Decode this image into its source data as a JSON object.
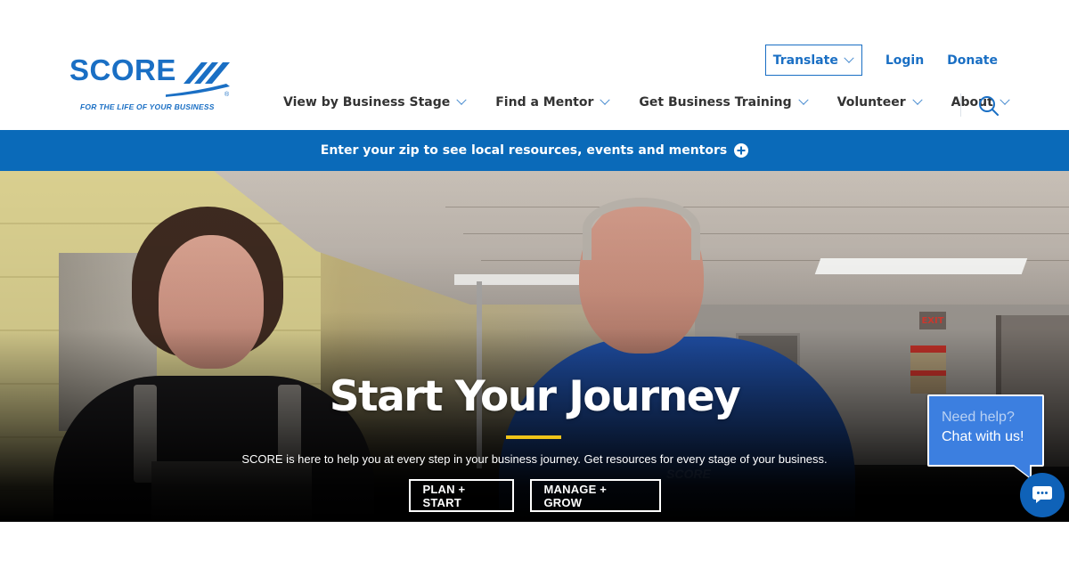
{
  "header": {
    "logo": {
      "wordmark": "SCORE",
      "registered": "®",
      "tagline": "FOR THE LIFE OF YOUR BUSINESS"
    },
    "utility": {
      "translate_label": "Translate",
      "login_label": "Login",
      "donate_label": "Donate"
    },
    "nav": [
      {
        "label": "View by Business Stage",
        "icon": "chevron-down-icon"
      },
      {
        "label": "Find a Mentor",
        "icon": "chevron-down-icon"
      },
      {
        "label": "Get Business Training",
        "icon": "chevron-down-icon"
      },
      {
        "label": "Volunteer",
        "icon": "chevron-down-icon"
      },
      {
        "label": "About",
        "icon": "chevron-down-icon"
      }
    ],
    "search_icon": "search-icon"
  },
  "zip_bar": {
    "text": "Enter your zip to see local resources, events and mentors",
    "icon": "plus-circle-icon"
  },
  "hero": {
    "title": "Start Your Journey",
    "subtitle": "SCORE is here to help you at every step in your business journey. Get resources for every stage of your business.",
    "buttons": [
      {
        "label": "PLAN + START"
      },
      {
        "label": "MANAGE + GROW"
      }
    ],
    "exit_sign": "EXIT",
    "shirt_logo": "SCORE"
  },
  "chat": {
    "line1": "Need help?",
    "line2": "Chat with us!",
    "icon": "chat-bubble-icon"
  },
  "colors": {
    "brand_blue": "#1a6fc4",
    "zip_bar_blue": "#0a6ab9",
    "accent_yellow": "#f0c419",
    "chat_blue": "#3c7fe0",
    "chat_fab_blue": "#0f62b8"
  }
}
